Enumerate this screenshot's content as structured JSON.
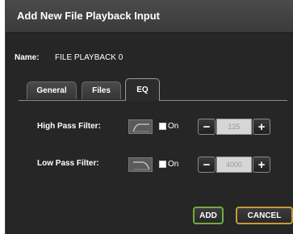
{
  "dialog": {
    "title": "Add New File Playback Input",
    "name_label": "Name:",
    "name_value": "FILE PLAYBACK 0"
  },
  "tabs": [
    {
      "label": "General",
      "active": false
    },
    {
      "label": "Files",
      "active": false
    },
    {
      "label": "EQ",
      "active": true
    }
  ],
  "filters": {
    "high_pass": {
      "label": "High Pass Filter:",
      "icon": "high-pass-filter-icon",
      "on_label": "On",
      "checked": false,
      "value": "125",
      "minus": "−",
      "plus": "+"
    },
    "low_pass": {
      "label": "Low Pass Filter:",
      "icon": "low-pass-filter-icon",
      "on_label": "On",
      "checked": false,
      "value": "4000",
      "minus": "−",
      "plus": "+"
    }
  },
  "buttons": {
    "add": "ADD",
    "cancel": "CANCEL"
  },
  "colors": {
    "add_border": "#6fae3a",
    "cancel_border": "#c79a3a",
    "dialog_bg": "#262626"
  }
}
